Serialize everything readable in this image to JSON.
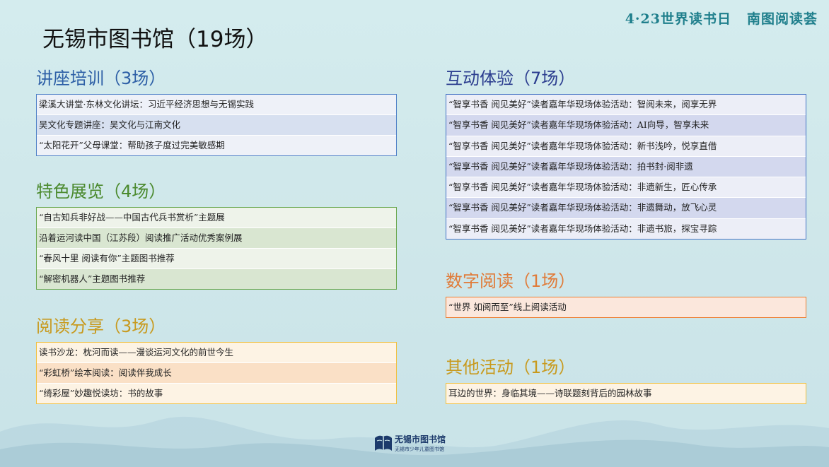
{
  "header": {
    "left_text": "4·23世界读书日",
    "right_text": "南图阅读荟"
  },
  "page_title": "无锡市图书馆（19场）",
  "sections": {
    "lecture": {
      "title": "讲座培训（3场）",
      "items": [
        "梁溪大讲堂·东林文化讲坛：习近平经济思想与无锡实践",
        "吴文化专题讲座：吴文化与江南文化",
        "“太阳花开”父母课堂：帮助孩子度过完美敏感期"
      ]
    },
    "exhibit": {
      "title": "特色展览（4场）",
      "items": [
        "“自古知兵非好战——中国古代兵书赏析”主题展",
        "沿着运河读中国（江苏段）阅读推广活动优秀案例展",
        "“春风十里  阅读有你”主题图书推荐",
        "“解密机器人”主题图书推荐"
      ]
    },
    "share": {
      "title": "阅读分享（3场）",
      "items": [
        "读书沙龙：枕河而读——漫谈运河文化的前世今生",
        "“彩虹桥”绘本阅读：阅读伴我成长",
        "“绮彩屋”妙趣悦读坊：书的故事"
      ]
    },
    "interact": {
      "title": "互动体验（7场）",
      "items": [
        "“智享书香 阅见美好”读者嘉年华现场体验活动：智阅未来，阅享无界",
        "“智享书香 阅见美好”读者嘉年华现场体验活动：AI向导，智享未来",
        "“智享书香 阅见美好”读者嘉年华现场体验活动：新书浅吟，悦享直借",
        "“智享书香 阅见美好”读者嘉年华现场体验活动：拍书封·阅非遗",
        "“智享书香 阅见美好”读者嘉年华现场体验活动：非遗新生，匠心传承",
        "“智享书香 阅见美好”读者嘉年华现场体验活动：非遗舞动，放飞心灵",
        "“智享书香 阅见美好”读者嘉年华现场体验活动：非遗书旅，探宝寻踪"
      ]
    },
    "digital": {
      "title": "数字阅读（1场）",
      "items": [
        "“世界 如阅而至”线上阅读活动"
      ]
    },
    "other": {
      "title": "其他活动（1场）",
      "items": [
        "耳边的世界：身临其境——诗联题刻背后的园林故事"
      ]
    }
  },
  "logo": {
    "name": "无锡市图书馆",
    "subtitle": "无锡市少年儿童图书馆"
  }
}
